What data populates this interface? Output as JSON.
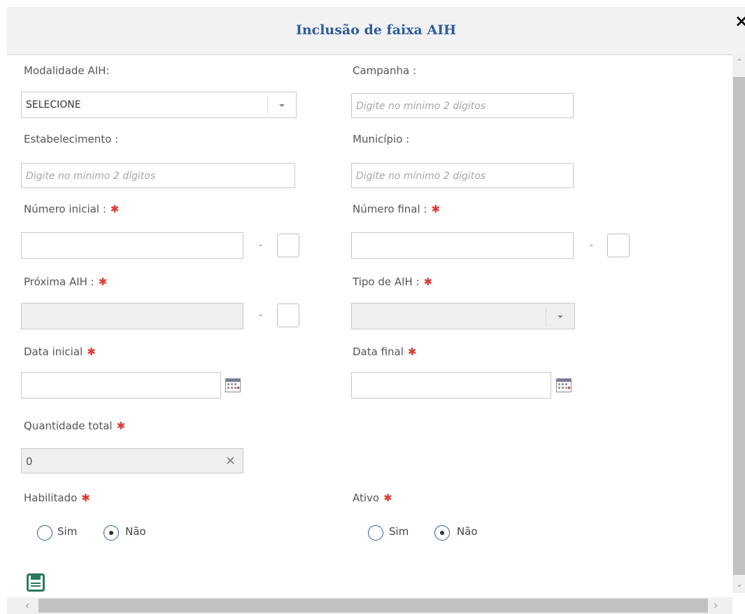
{
  "dialog": {
    "title": "Inclusão de faixa AIH",
    "close_label": "×"
  },
  "form": {
    "modalidade_label": "Modalidade AIH:",
    "modalidade_value": "SELECIONE",
    "campanha_label": "Campanha :",
    "campanha_placeholder": "Digite no mínimo 2 dígitos",
    "estabelecimento_label": "Estabelecimento :",
    "estabelecimento_placeholder": "Digite no mínimo 2 dígitos",
    "municipio_label": "Município :",
    "municipio_placeholder": "Digite no mínimo 2 dígitos",
    "numero_inicial_label": "Número inicial :",
    "numero_inicial_value": "",
    "numero_final_label": "Número final :",
    "numero_final_value": "",
    "separator": "-",
    "proxima_aih_label": "Próxima AIH :",
    "proxima_aih_value": "",
    "tipo_aih_label": "Tipo de AIH :",
    "tipo_aih_value": "",
    "data_inicial_label": "Data inicial",
    "data_inicial_value": "",
    "data_final_label": "Data final",
    "data_final_value": "",
    "quantidade_label": "Quantidade total",
    "quantidade_value": "0",
    "clear_label": "×",
    "habilitado_label": "Habilitado",
    "ativo_label": "Ativo",
    "radio_sim": "Sim",
    "radio_nao": "Não",
    "required_mark": "✱",
    "habilitado_selected": "Não",
    "ativo_selected": "Não"
  },
  "colors": {
    "title": "#2f5d9a",
    "required": "#e0392f",
    "save_icon": "#2a7a5a"
  },
  "icons": {
    "close": "close-icon",
    "dropdown": "chevron-down-icon",
    "calendar": "calendar-icon",
    "clear": "clear-icon",
    "save": "save-icon"
  }
}
